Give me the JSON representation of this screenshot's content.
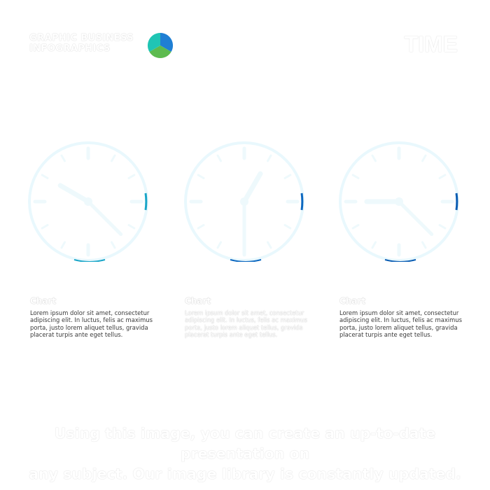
{
  "header": {
    "brand_line1": "GRAPHIC BUSINESS",
    "brand_line2": "INFOGRAPHICS",
    "title": "TIME",
    "logo_colors": [
      "#1f7fd4",
      "#5dbb4f",
      "#1fc5b4"
    ]
  },
  "clocks": [
    {
      "hour_deg": 300,
      "minute_deg": 135,
      "accent": "#1aa6c8"
    },
    {
      "hour_deg": 30,
      "minute_deg": 180,
      "accent": "#0d68c0"
    },
    {
      "hour_deg": 270,
      "minute_deg": 135,
      "accent": "#0a5db3"
    }
  ],
  "cards": [
    {
      "title": "Chart",
      "text": "Lorem ipsum dolor sit amet, consectetur adipiscing elit. In luctus, felis ac maximus porta, justo lorem aliquet tellus, gravida placerat turpis ante eget tellus."
    },
    {
      "title": "Chart",
      "text": "Lorem ipsum dolor sit amet, consectetur adipiscing elit. In luctus, felis ac maximus porta, justo lorem aliquet tellus, gravida placerat turpis ante eget tellus."
    },
    {
      "title": "Chart",
      "text": "Lorem ipsum dolor sit amet, consectetur adipiscing elit. In luctus, felis ac maximus porta, justo lorem aliquet tellus, gravida placerat turpis ante eget tellus."
    }
  ],
  "footer": {
    "line1": "Using this image, you can create an up-to-date presentation on",
    "line2": "any subject. Our image library is constantly updated."
  }
}
